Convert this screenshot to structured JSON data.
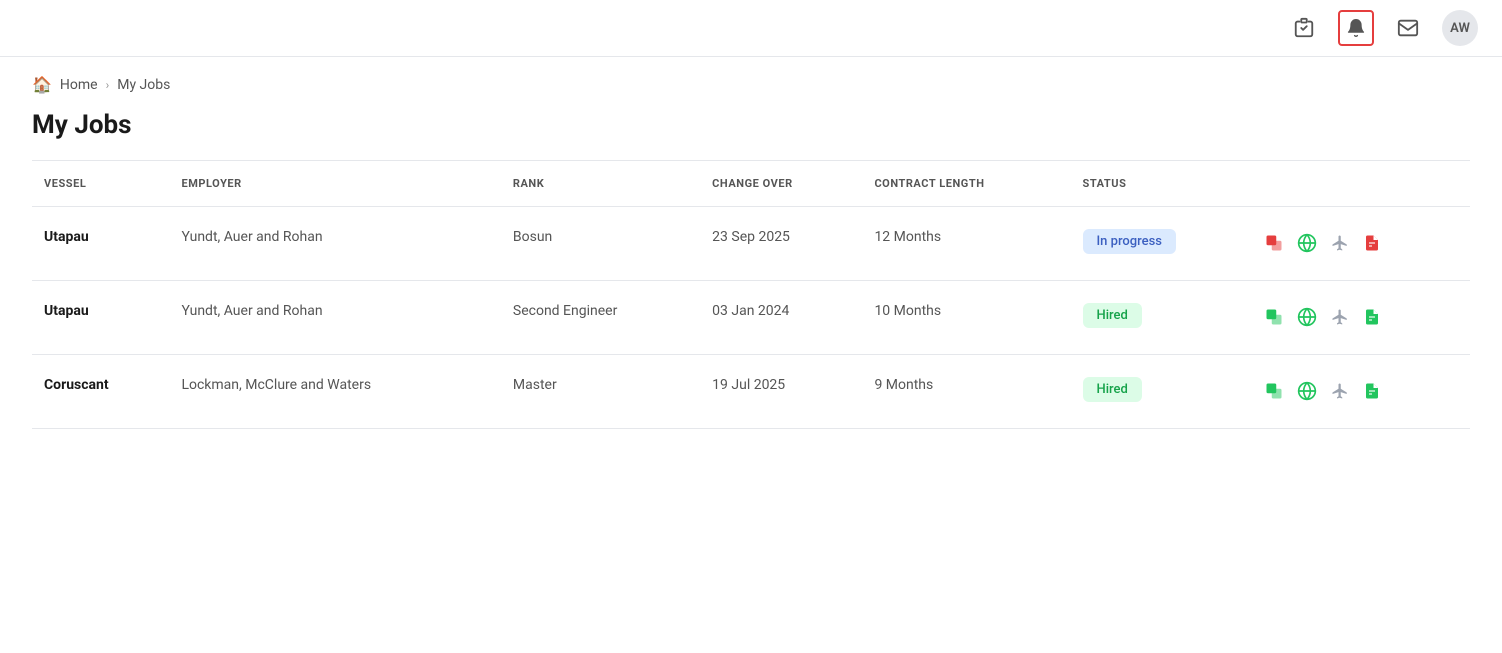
{
  "topbar": {
    "checklist_icon": "☑",
    "bell_icon": "🔔",
    "mail_icon": "✉",
    "avatar_label": "AW"
  },
  "breadcrumb": {
    "home_label": "Home",
    "separator": "›",
    "current": "My Jobs"
  },
  "page": {
    "title": "My Jobs"
  },
  "table": {
    "columns": [
      "VESSEL",
      "EMPLOYER",
      "RANK",
      "CHANGE OVER",
      "CONTRACT LENGTH",
      "STATUS"
    ],
    "rows": [
      {
        "vessel": "Utapau",
        "employer": "Yundt, Auer and Rohan",
        "rank": "Bosun",
        "changeover": "23 Sep 2025",
        "contract_length": "12 Months",
        "status": "In progress",
        "status_type": "inprogress"
      },
      {
        "vessel": "Utapau",
        "employer": "Yundt, Auer and Rohan",
        "rank": "Second Engineer",
        "changeover": "03 Jan 2024",
        "contract_length": "10 Months",
        "status": "Hired",
        "status_type": "hired"
      },
      {
        "vessel": "Coruscant",
        "employer": "Lockman, McClure and Waters",
        "rank": "Master",
        "changeover": "19 Jul 2025",
        "contract_length": "9 Months",
        "status": "Hired",
        "status_type": "hired"
      }
    ]
  }
}
